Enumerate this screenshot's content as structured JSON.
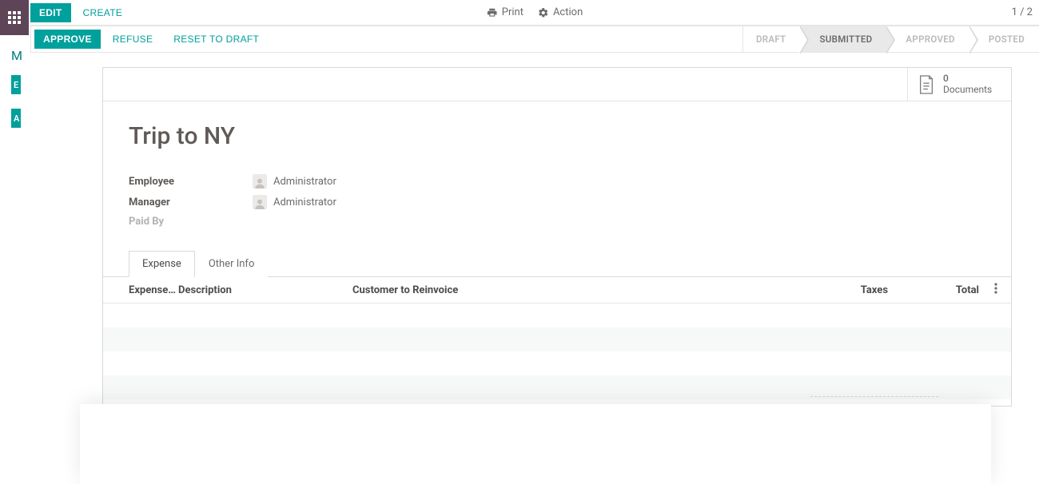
{
  "toolbar": {
    "edit": "EDIT",
    "create": "CREATE",
    "print": "Print",
    "action": "Action",
    "pager": "1 / 2"
  },
  "workflow": {
    "approve": "APPROVE",
    "refuse": "REFUSE",
    "reset": "RESET TO DRAFT"
  },
  "status_steps": [
    "DRAFT",
    "SUBMITTED",
    "APPROVED",
    "POSTED"
  ],
  "status_active_index": 1,
  "documents": {
    "count": "0",
    "label": "Documents"
  },
  "record": {
    "title": "Trip to NY",
    "fields": {
      "employee_label": "Employee",
      "employee_value": "Administrator",
      "manager_label": "Manager",
      "manager_value": "Administrator",
      "paidby_label": "Paid By"
    }
  },
  "tabs": {
    "expense": "Expense",
    "other": "Other Info"
  },
  "columns": {
    "date": "Expense Date",
    "description": "Description",
    "customer": "Customer to Reinvoice",
    "taxes": "Taxes",
    "total": "Total"
  },
  "left_remnants": {
    "letter": "M",
    "b1": "E",
    "b2": "A"
  }
}
